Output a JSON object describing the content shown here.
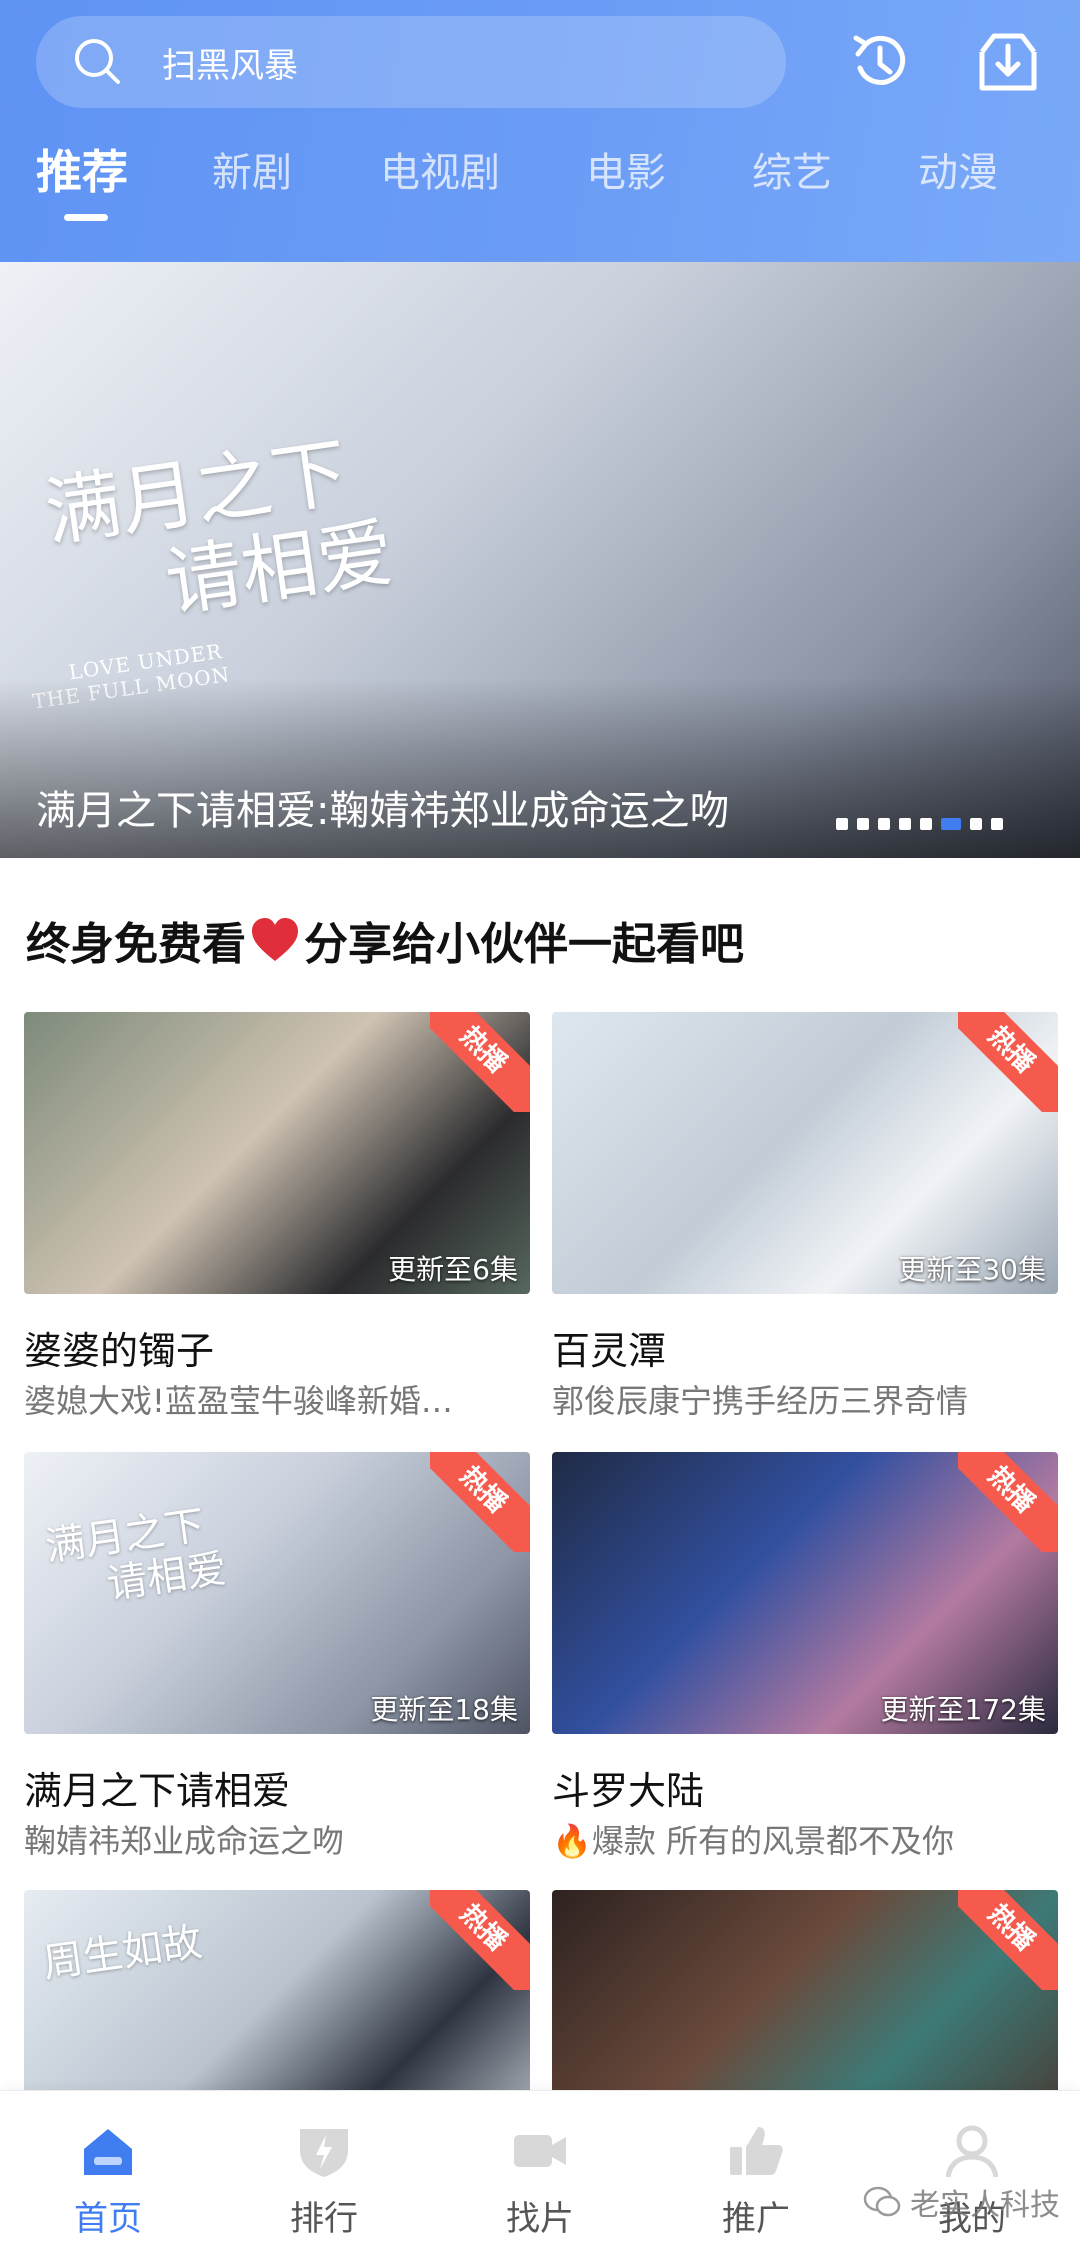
{
  "search": {
    "text": "扫黑风暴"
  },
  "tabs": [
    {
      "label": "推荐"
    },
    {
      "label": "新剧"
    },
    {
      "label": "电视剧"
    },
    {
      "label": "电影"
    },
    {
      "label": "综艺"
    },
    {
      "label": "动漫"
    }
  ],
  "banner": {
    "art_title_line1": "满月之下",
    "art_title_line2": "请相爱",
    "art_subtitle_line1": "LOVE UNDER",
    "art_subtitle_line2": "THE FULL MOON",
    "caption": "满月之下请相爱:鞠婧祎郑业成命运之吻",
    "dot_count": 8,
    "active_dot": 5
  },
  "section": {
    "title_part1": "终身免费看",
    "title_part2": "分享给小伙伴一起看吧"
  },
  "cards": [
    {
      "title": "婆婆的镯子",
      "desc": "婆媳大戏!蓝盈莹牛骏峰新婚…",
      "badge": "热播",
      "episodes": "更新至6集"
    },
    {
      "title": "百灵潭",
      "desc": "郭俊辰康宁携手经历三界奇情",
      "badge": "热播",
      "episodes": "更新至30集"
    },
    {
      "title": "满月之下请相爱",
      "desc": "鞠婧祎郑业成命运之吻",
      "badge": "热播",
      "episodes": "更新至18集"
    },
    {
      "title": "斗罗大陆",
      "desc": "🔥爆款 所有的风景都不及你",
      "badge": "热播",
      "episodes": "更新至172集"
    },
    {
      "badge": "热播",
      "poster_text": "周生如故"
    },
    {
      "badge": "热播"
    }
  ],
  "nav": [
    {
      "label": "首页",
      "icon": "home-icon"
    },
    {
      "label": "排行",
      "icon": "ranking-icon"
    },
    {
      "label": "找片",
      "icon": "video-camera-icon"
    },
    {
      "label": "推广",
      "icon": "thumbs-up-icon"
    },
    {
      "label": "我的",
      "icon": "user-icon"
    }
  ],
  "watermark": {
    "text": "老实人科技"
  },
  "colors": {
    "accent": "#3f7df0",
    "header": "#6a9cf6",
    "badge": "#f65a4c"
  }
}
